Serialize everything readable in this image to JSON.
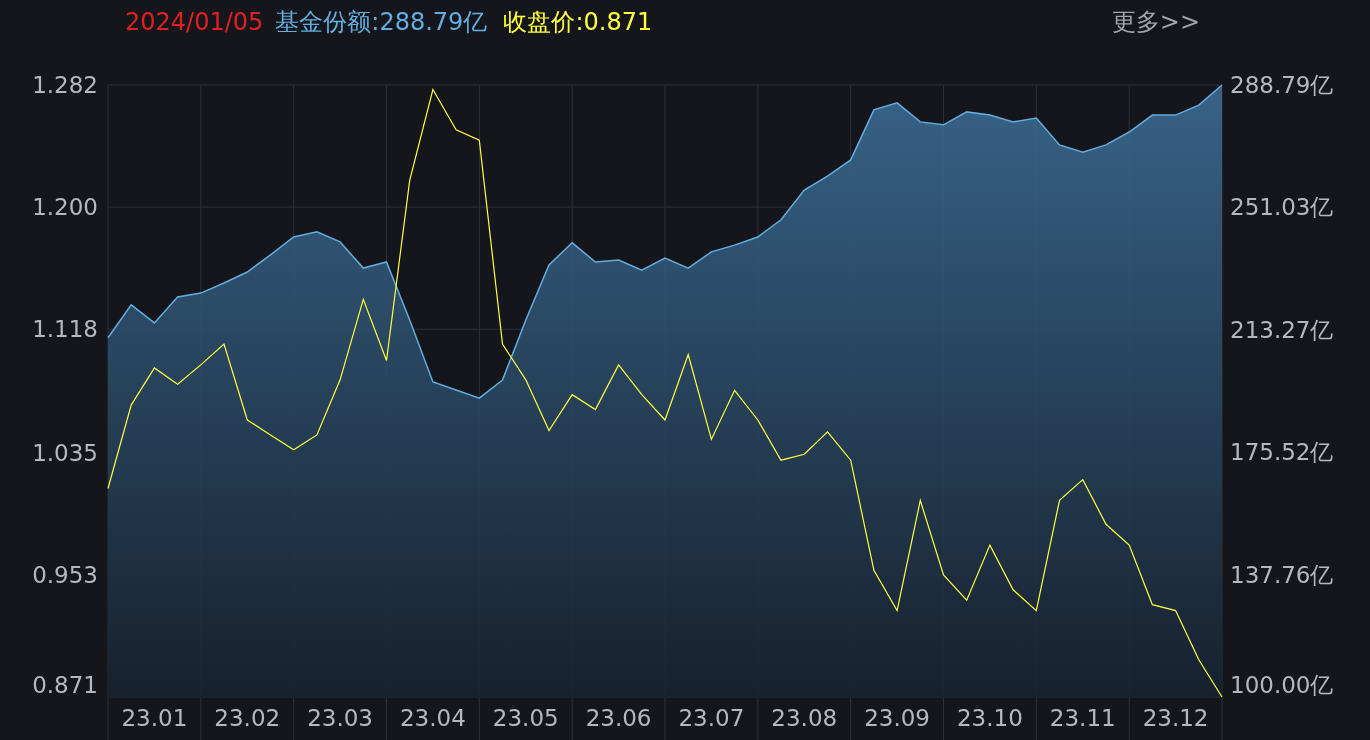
{
  "header": {
    "date": "2024/01/05",
    "fund_share": "基金份额:288.79亿",
    "close_price": "收盘价:0.871",
    "more_link": "更多>>"
  },
  "chart_data": {
    "type": "area",
    "grid": true,
    "categories": [
      null,
      null,
      "23.01",
      null,
      null,
      null,
      "23.02",
      null,
      null,
      null,
      "23.03",
      null,
      null,
      null,
      "23.04",
      null,
      null,
      null,
      "23.05",
      null,
      null,
      null,
      "23.06",
      null,
      null,
      null,
      "23.07",
      null,
      null,
      null,
      "23.08",
      null,
      null,
      null,
      "23.09",
      null,
      null,
      null,
      "23.10",
      null,
      null,
      null,
      "23.11",
      null,
      null,
      null,
      "23.12",
      null,
      null
    ],
    "series": [
      {
        "axis": "y2",
        "color": "#62aee0",
        "values": [
          210.8,
          221,
          215.4,
          223.4,
          224.6,
          227.7,
          231.1,
          236.4,
          241.9,
          243.5,
          240.4,
          232.3,
          234.2,
          216.3,
          197.2,
          194.7,
          192.2,
          197.8,
          216.3,
          233.3,
          240.1,
          234.2,
          234.8,
          231.7,
          235.4,
          232.3,
          237.3,
          239.4,
          241.9,
          247.2,
          256.4,
          260.7,
          265.7,
          281.1,
          283.3,
          277.4,
          276.5,
          280.5,
          279.5,
          277.4,
          278.6,
          270.3,
          268.1,
          270.3,
          274.3,
          279.5,
          279.5,
          282.6,
          288.79
        ]
      },
      {
        "type": "line",
        "color": "#ffff3c",
        "values": [
          1.011,
          1.067,
          1.092,
          1.081,
          1.094,
          1.108,
          1.057,
          1.047,
          1.037,
          1.047,
          1.084,
          1.138,
          1.097,
          1.218,
          1.279,
          1.252,
          1.245,
          1.108,
          1.084,
          1.05,
          1.074,
          1.064,
          1.094,
          1.074,
          1.057,
          1.101,
          1.044,
          1.077,
          1.057,
          1.03,
          1.034,
          1.049,
          1.03,
          0.956,
          0.929,
          1.003,
          0.953,
          0.936,
          0.973,
          0.943,
          0.929,
          1.003,
          1.017,
          0.987,
          0.973,
          0.933,
          0.929,
          0.896,
          0.871
        ]
      }
    ],
    "ylim": [
      0.871,
      1.282
    ],
    "y2lim": [
      100,
      288.79
    ],
    "yticks": [
      {
        "value": 0.871,
        "label": "0.871"
      },
      {
        "value": 0.953,
        "label": "0.953"
      },
      {
        "value": 1.035,
        "label": "1.035"
      },
      {
        "value": 1.118,
        "label": "1.118"
      },
      {
        "value": 1.2,
        "label": "1.200"
      },
      {
        "value": 1.282,
        "label": "1.282"
      }
    ],
    "y2ticks": [
      {
        "value": 100,
        "label": "100.00亿"
      },
      {
        "value": 137.76,
        "label": "137.76亿"
      },
      {
        "value": 175.52,
        "label": "175.52亿"
      },
      {
        "value": 213.27,
        "label": "213.27亿"
      },
      {
        "value": 251.03,
        "label": "251.03亿"
      },
      {
        "value": 288.79,
        "label": "288.79亿"
      }
    ]
  }
}
